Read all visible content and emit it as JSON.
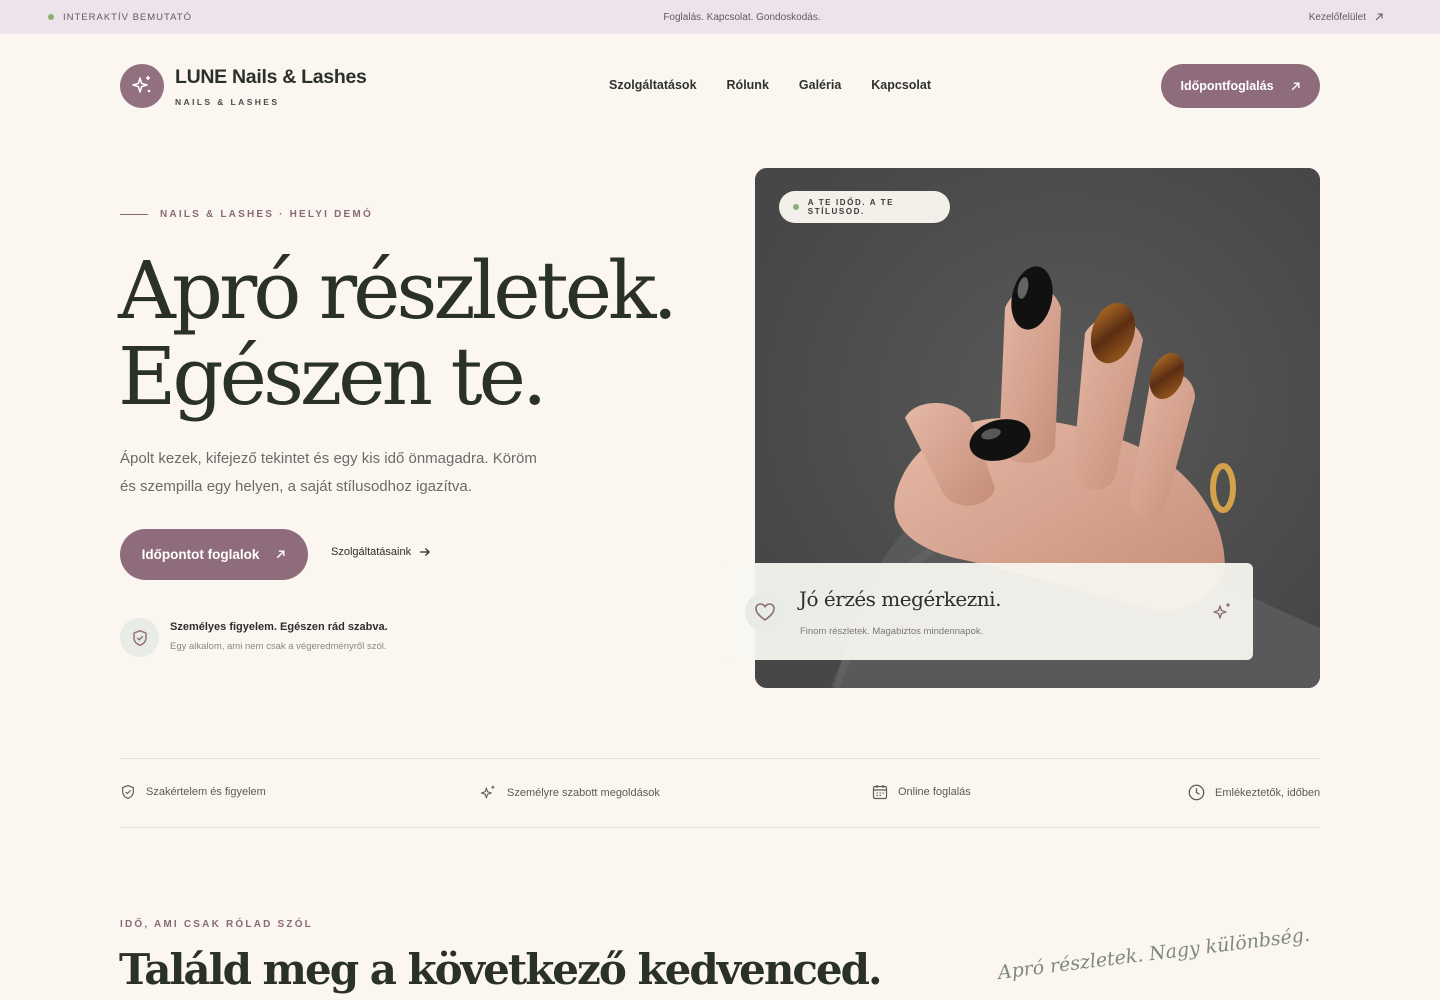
{
  "topbar": {
    "demo_label": "INTERAKTÍV BEMUTATÓ",
    "tagline": "Foglalás. Kapcsolat. Gondoskodás.",
    "admin_link": "Kezelőfelület"
  },
  "header": {
    "brand_name": "LUNE Nails & Lashes",
    "brand_sub": "NAILS & LASHES",
    "nav": [
      "Szolgáltatások",
      "Rólunk",
      "Galéria",
      "Kapcsolat"
    ],
    "cta_label": "Időpontfoglalás"
  },
  "hero": {
    "eyebrow": "NAILS & LASHES · HELYI DEMÓ",
    "title_line1": "Apró részletek.",
    "title_line2": "Egészen te.",
    "description": "Ápolt kezek, kifejező tekintet és egy kis idő önmagadra. Köröm és szempilla egy helyen, a saját stílusodhoz igazítva.",
    "cta_label": "Időpontot foglalok",
    "secondary_link": "Szolgáltatásaink",
    "trust_title": "Személyes figyelem. Egészen rád szabva.",
    "trust_sub": "Egy alkalom, ami nem csak a végeredményről szól."
  },
  "photo": {
    "pill": "A TE IDŐD. A TE STÍLUSOD.",
    "card_title": "Jó érzés megérkezni.",
    "card_sub": "Finom részletek. Magabiztos mindennapok."
  },
  "features": [
    {
      "label": "Szakértelem és figyelem",
      "icon": "shield-check-icon"
    },
    {
      "label": "Személyre szabott megoldások",
      "icon": "sparkle-icon"
    },
    {
      "label": "Online foglalás",
      "icon": "calendar-icon"
    },
    {
      "label": "Emlékeztetők, időben",
      "icon": "clock-icon"
    }
  ],
  "section": {
    "eyebrow": "IDŐ, AMI CSAK RÓLAD SZÓL",
    "title": "Találd meg a következő kedvenced.",
    "handwritten": "Apró részletek. Nagy különbség."
  },
  "colors": {
    "accent": "#8f6c7b",
    "background": "#fcf6f1",
    "topbar": "#ece4ea",
    "status_dot": "#8ab07a"
  }
}
